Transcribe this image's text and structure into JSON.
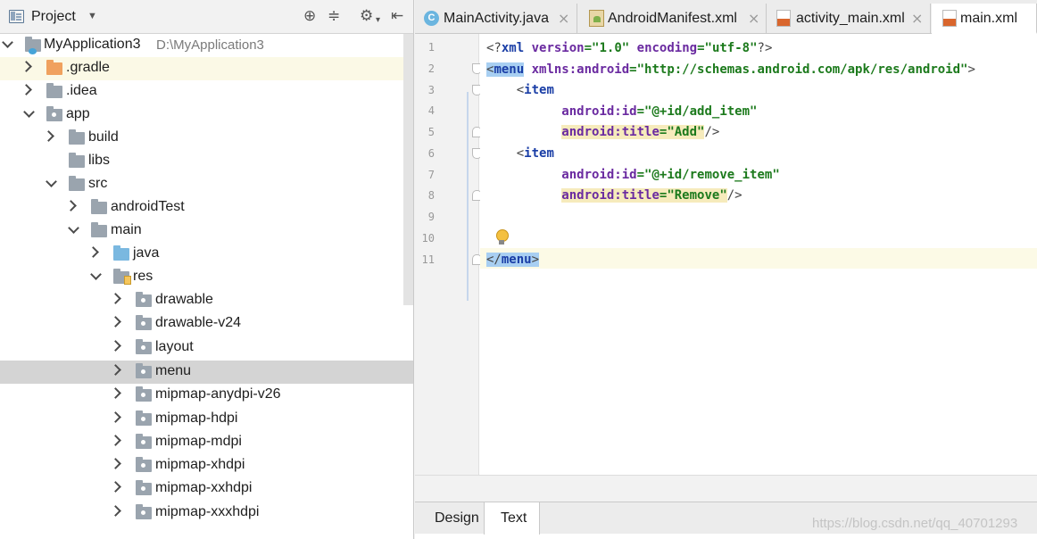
{
  "project_panel": {
    "title": "Project",
    "tools": [
      "crosshair-icon",
      "collapse-icon",
      "gear-icon",
      "hide-icon"
    ]
  },
  "tree": {
    "rows": [
      {
        "label": "MyApplication3",
        "path": "D:\\MyApplication3"
      },
      {
        "label": ".gradle"
      },
      {
        "label": ".idea"
      },
      {
        "label": "app"
      },
      {
        "label": "build"
      },
      {
        "label": "libs"
      },
      {
        "label": "src"
      },
      {
        "label": "androidTest"
      },
      {
        "label": "main"
      },
      {
        "label": "java"
      },
      {
        "label": "res"
      },
      {
        "label": "drawable"
      },
      {
        "label": "drawable-v24"
      },
      {
        "label": "layout"
      },
      {
        "label": "menu"
      },
      {
        "label": "mipmap-anydpi-v26"
      },
      {
        "label": "mipmap-hdpi"
      },
      {
        "label": "mipmap-mdpi"
      },
      {
        "label": "mipmap-xhdpi"
      },
      {
        "label": "mipmap-xxhdpi"
      },
      {
        "label": "mipmap-xxxhdpi"
      }
    ],
    "selected": "menu"
  },
  "editor": {
    "tabs": [
      {
        "label": "MainActivity.java",
        "icon": "java-class-icon"
      },
      {
        "label": "AndroidManifest.xml",
        "icon": "manifest-icon"
      },
      {
        "label": "activity_main.xml",
        "icon": "xml-file-icon"
      },
      {
        "label": "main.xml",
        "icon": "xml-file-icon",
        "active": true
      }
    ],
    "line_numbers": [
      "1",
      "2",
      "3",
      "4",
      "5",
      "6",
      "7",
      "8",
      "9",
      "10",
      "11"
    ],
    "code": {
      "l1": {
        "open": "<?",
        "tag": "xml",
        "a1": "version",
        "eq1": "=",
        "v1": "\"1.0\"",
        "a2": "encoding",
        "eq2": "=",
        "v2": "\"utf-8\"",
        "close": "?>"
      },
      "l2": {
        "open": "<",
        "tag": "menu",
        "a1": "xmlns:android",
        "eq1": "=",
        "v1": "\"http://schemas.android.com/apk/res/android\"",
        "close": ">"
      },
      "l3": {
        "open": "<",
        "tag": "item"
      },
      "l4": {
        "a1": "android:id",
        "eq1": "=",
        "v1": "\"@+id/add_item\""
      },
      "l5": {
        "a1": "android:title",
        "eq1": "=",
        "v1": "\"Add\"",
        "close": "/>"
      },
      "l6": {
        "open": "<",
        "tag": "item"
      },
      "l7": {
        "a1": "android:id",
        "eq1": "=",
        "v1": "\"@+id/remove_item\""
      },
      "l8": {
        "a1": "android:title",
        "eq1": "=",
        "v1": "\"Remove\"",
        "close": "/>"
      },
      "l11": {
        "open": "</",
        "tag": "menu",
        "close": ">"
      }
    }
  },
  "bottom_tabs": {
    "design": "Design",
    "text": "Text",
    "active": "Text"
  },
  "watermark": "https://blog.csdn.net/qq_40701293",
  "colors": {
    "tag": "#1a3ea6",
    "attribute": "#6a2aa0",
    "value": "#1c7a1c",
    "selected_row": "#d4d4d4",
    "current_line": "#fcfae6"
  }
}
